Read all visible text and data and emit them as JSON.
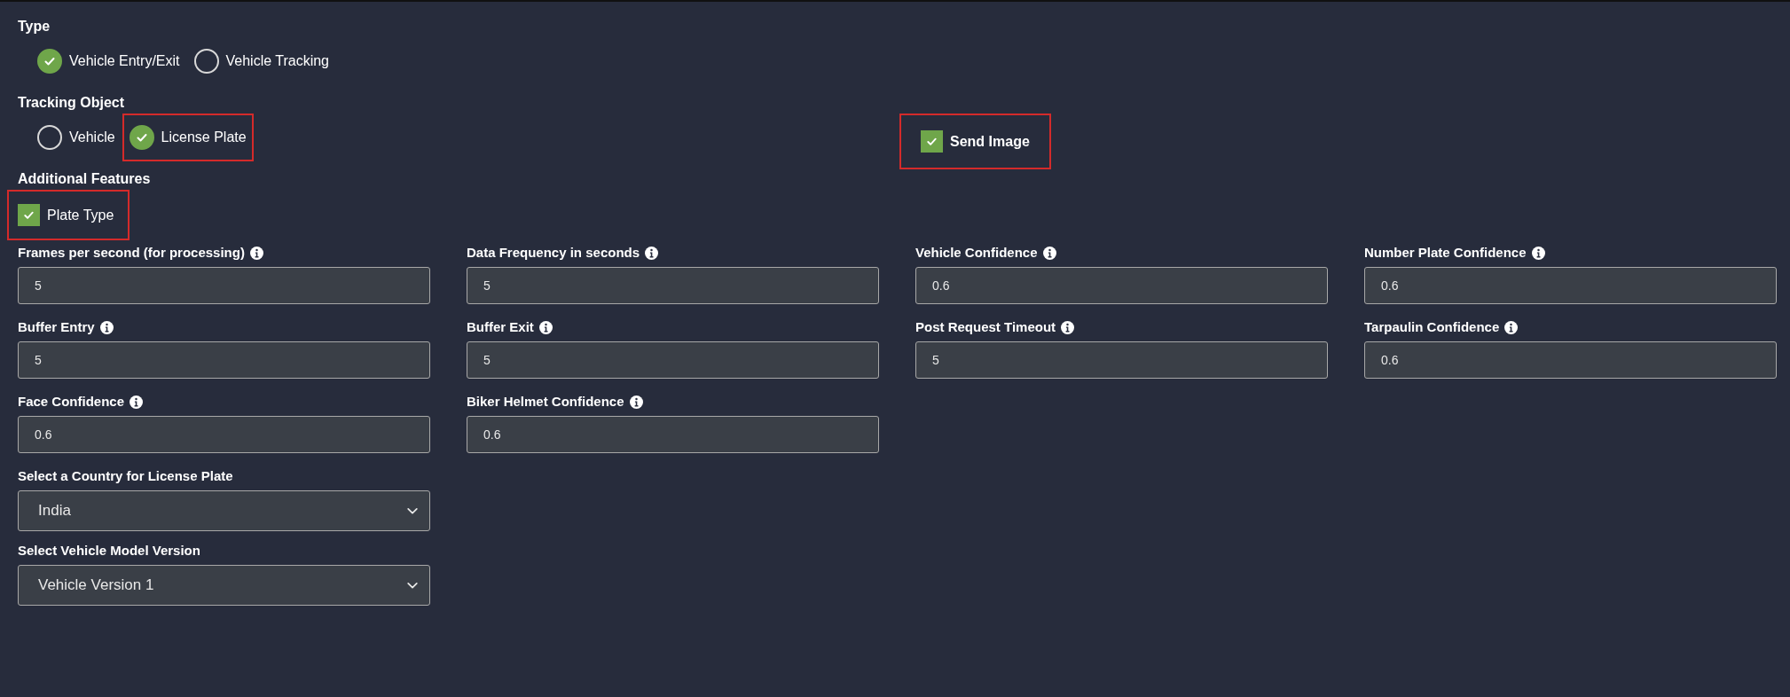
{
  "type_group": {
    "label": "Type",
    "options": [
      {
        "label": "Vehicle Entry/Exit",
        "selected": true,
        "highlighted": false
      },
      {
        "label": "Vehicle Tracking",
        "selected": false,
        "highlighted": false
      }
    ]
  },
  "tracking_object": {
    "label": "Tracking Object",
    "options": [
      {
        "label": "Vehicle",
        "selected": false,
        "highlighted": false
      },
      {
        "label": "License Plate",
        "selected": true,
        "highlighted": true
      }
    ]
  },
  "send_image": {
    "label": "Send Image",
    "checked": true,
    "highlighted": true
  },
  "additional_features": {
    "label": "Additional Features",
    "options": [
      {
        "label": "Plate Type",
        "checked": true,
        "highlighted": true
      }
    ]
  },
  "fields": [
    {
      "label": "Frames per second (for processing)",
      "value": "5"
    },
    {
      "label": "Data Frequency in seconds",
      "value": "5"
    },
    {
      "label": "Vehicle Confidence",
      "value": "0.6"
    },
    {
      "label": "Number Plate Confidence",
      "value": "0.6"
    },
    {
      "label": "Buffer Entry",
      "value": "5"
    },
    {
      "label": "Buffer Exit",
      "value": "5"
    },
    {
      "label": "Post Request Timeout",
      "value": "5"
    },
    {
      "label": "Tarpaulin Confidence",
      "value": "0.6"
    },
    {
      "label": "Face Confidence",
      "value": "0.6"
    },
    {
      "label": "Biker Helmet Confidence",
      "value": "0.6"
    }
  ],
  "selects": [
    {
      "label": "Select a Country for License Plate",
      "value": "India"
    },
    {
      "label": "Select Vehicle Model Version",
      "value": "Vehicle Version 1"
    }
  ]
}
